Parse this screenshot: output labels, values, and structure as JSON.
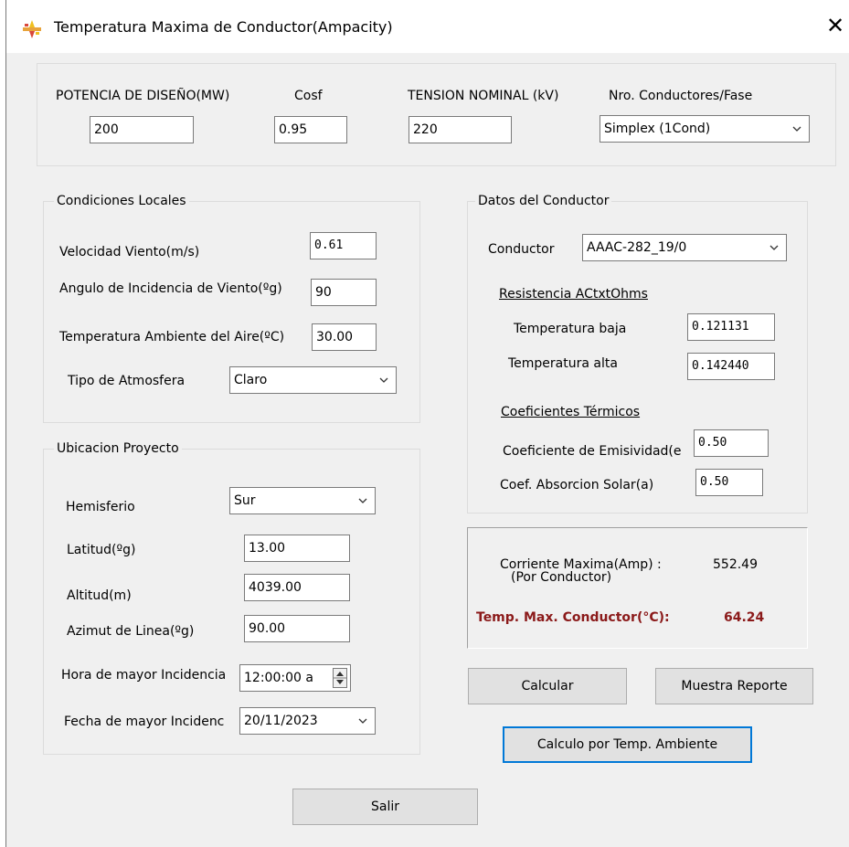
{
  "window": {
    "title": "Temperatura Maxima de Conductor(Ampacity)",
    "close_icon": "close-icon",
    "app_icon": "app-icon"
  },
  "design": {
    "potencia_label": "POTENCIA DE DISEÑO(MW)",
    "potencia_value": "200",
    "cosf_label": "Cosf",
    "cosf_value": "0.95",
    "tension_label": "TENSION NOMINAL (kV)",
    "tension_value": "220",
    "conductores_label": "Nro. Conductores/Fase",
    "conductores_value": "Simplex (1Cond)"
  },
  "condiciones": {
    "title": "Condiciones Locales",
    "velocidad_label": "Velocidad Viento(m/s)",
    "velocidad_value": "0.61",
    "angulo_label": "Angulo de Incidencia de Viento(ºg)",
    "angulo_value": "90",
    "temp_label": "Temperatura Ambiente del Aire(ºC)",
    "temp_value": "30.00",
    "atmosfera_label": "Tipo de Atmosfera",
    "atmosfera_value": "Claro"
  },
  "ubicacion": {
    "title": "Ubicacion Proyecto",
    "hemisferio_label": "Hemisferio",
    "hemisferio_value": "Sur",
    "latitud_label": "Latitud(ºg)",
    "latitud_value": "13.00",
    "altitud_label": "Altitud(m)",
    "altitud_value": "4039.00",
    "azimut_label": "Azimut de Linea(ºg)",
    "azimut_value": "90.00",
    "hora_label": "Hora de mayor Incidencia",
    "hora_value": "12:00:00 a",
    "fecha_label": "Fecha de mayor Incidenc",
    "fecha_value": "20/11/2023"
  },
  "conductor": {
    "title": "Datos del Conductor",
    "conductor_label": "Conductor",
    "conductor_value": "AAAC-282_19/0",
    "resistencia_heading": "Resistencia ACtxtOhms",
    "temp_baja_label": "Temperatura baja",
    "temp_baja_value": "0.121131",
    "temp_alta_label": "Temperatura alta",
    "temp_alta_value": "0.142440",
    "coef_heading": "Coeficientes Térmicos",
    "emisividad_label": "Coeficiente de Emisividad(e",
    "emisividad_value": "0.50",
    "absorcion_label": "Coef. Absorcion Solar(a)",
    "absorcion_value": "0.50"
  },
  "results": {
    "corriente_label": "Corriente Maxima(Amp) :",
    "corriente_sub": "(Por Conductor)",
    "corriente_value": "552.49",
    "temp_label": "Temp. Max. Conductor(°C):",
    "temp_value": "64.24"
  },
  "buttons": {
    "calcular": "Calcular",
    "muestra_reporte": "Muestra Reporte",
    "calculo_temp": "Calculo por Temp. Ambiente",
    "salir": "Salir"
  }
}
